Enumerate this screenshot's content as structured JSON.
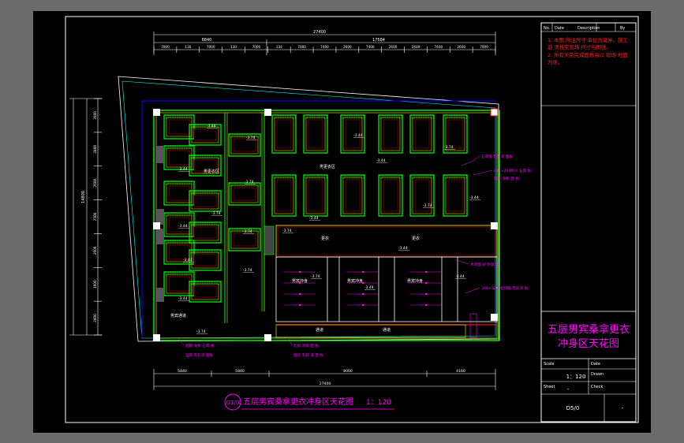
{
  "colors": {
    "background": "#6b6b6b",
    "sheet": "#000000",
    "frame": "#ffffff",
    "wall": "#00ff00",
    "room_outline": "#ffff00",
    "dimension": "#ffffff",
    "annotation": "#ff00ff",
    "border_blue": "#0000ff",
    "cut_red": "#ff0000",
    "cyan": "#00ffff",
    "notes_red": "#ff0000"
  },
  "drawing_title": {
    "number": "D1/0",
    "title": "五层男宾桑拿更衣冲身区天花图",
    "scale": "1：120"
  },
  "dimensions": {
    "top_total": "27400",
    "top_sub": [
      "8840",
      "17584"
    ],
    "top_detail": [
      "7000",
      "130",
      "7000",
      "130",
      "7000",
      "134",
      "7000",
      "7400",
      "2600",
      "7400",
      "2600",
      "2400",
      "7400",
      "2600",
      "7000"
    ],
    "bottom_detail": [
      "5840",
      "5840",
      "8000",
      "4160"
    ],
    "bottom_total": "27400",
    "left_total": "14800",
    "left_detail": [
      "2000",
      "2800",
      "2600",
      "2500",
      "2600",
      "1600",
      "2000"
    ]
  },
  "elevations": [
    "-3.44",
    "-3.74",
    "-3.44",
    "-3.74",
    "-3.44",
    "-3.74",
    "-3.44",
    "-3.74",
    "-3.44",
    "-3.74",
    "-3.44",
    "-3.74",
    "-3.44",
    "-3.74",
    "-3.44",
    "-3.74",
    "-3.44",
    "-3.74",
    "-3.44",
    "-3.44",
    "-3.74",
    "-3.44"
  ],
  "room_labels": [
    "男更衣区",
    "男更衣区",
    "更衣",
    "更衣",
    "男宾冲身",
    "男宾冲身",
    "男宾冲身",
    "男宾通道",
    "通道",
    "通道"
  ],
  "callouts": [
    "石膏板 乳胶漆 面板",
    "244×244防火 石膏 板",
    "乳胶 涂料 面 板",
    "木饰面 刷 防腐 漆",
    "300×1200铝扣板 乳胶漆 板",
    "轻钢 龙骨 石膏 板",
    "石膏 乳胶漆 面板",
    "乳胶 涂料 面 板",
    "图示 乳胶 漆 面 板"
  ],
  "legend": {
    "header": [
      "No.",
      "Date",
      "Description",
      "By"
    ],
    "notes": [
      "1. 本图 所注尺寸 单位为毫米，施工前 须核实现场 尺寸与图纸。",
      "2. 所有天花完成面标高以 现场 地面为准。"
    ]
  },
  "title_block": {
    "project_title_line1": "五层男宾桑拿更衣",
    "project_title_line2": "冲身区天花图",
    "scale_label": "Scale",
    "scale_value": "1：120",
    "date_label": "Date",
    "drawn_label": "Drawn",
    "checked_label": "Check",
    "sheet_label": "Sheet",
    "drawing_no": "D5/0",
    "rev": "-",
    "rev2": "-"
  }
}
